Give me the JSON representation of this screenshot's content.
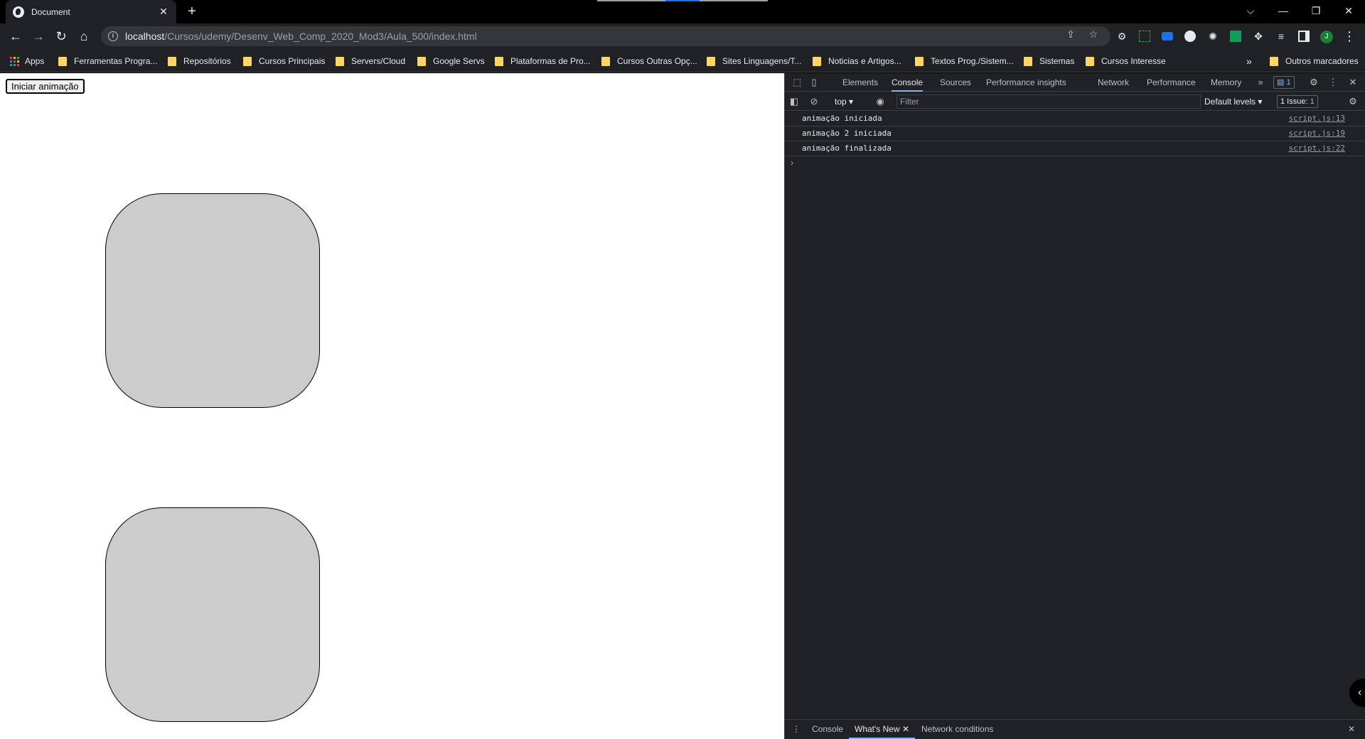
{
  "browser": {
    "tab_title": "Document",
    "tab_close": "✕",
    "new_tab": "+",
    "url_host": "localhost",
    "url_path": "/Cursos/udemy/Desenv_Web_Comp_2020_Mod3/Aula_500/index.html",
    "profile_initial": "J"
  },
  "bookmarks": [
    "Apps",
    "Ferramentas Progra...",
    "Repositórios",
    "Cursos Principais",
    "Servers/Cloud",
    "Google Servs",
    "Plataformas de Pro...",
    "Cursos Outras Opç...",
    "Sites Linguagens/T...",
    "Noticias e Artigos...",
    "Textos Prog./Sistem...",
    "Sistemas",
    "Cursos Interesse"
  ],
  "bookmarks_overflow": "»",
  "other_bookmarks": "Outros marcadores",
  "page": {
    "button_label": "Iniciar animação"
  },
  "devtools": {
    "tabs": [
      "Elements",
      "Console",
      "Sources",
      "Performance insights",
      "Network",
      "Performance",
      "Memory"
    ],
    "active_tab": "Console",
    "more_tabs": "»",
    "issues_badge": "1",
    "context": "top",
    "filter_placeholder": "Filter",
    "levels": "Default levels",
    "issues_counter": "1 Issue:",
    "issues_count": "1",
    "logs": [
      {
        "message": "animação iniciada",
        "source": "script.js:13"
      },
      {
        "message": "animação 2 iniciada",
        "source": "script.js:19"
      },
      {
        "message": "animação finalizada",
        "source": "script.js:22"
      }
    ],
    "prompt": "›",
    "drawer_tabs": [
      "Console",
      "What's New",
      "Network conditions"
    ],
    "drawer_active": "What's New"
  },
  "colors": {
    "accent": "#8ab4f8",
    "box_fill": "#cccccc",
    "folder": "#fdd663",
    "profile": "#188038"
  }
}
